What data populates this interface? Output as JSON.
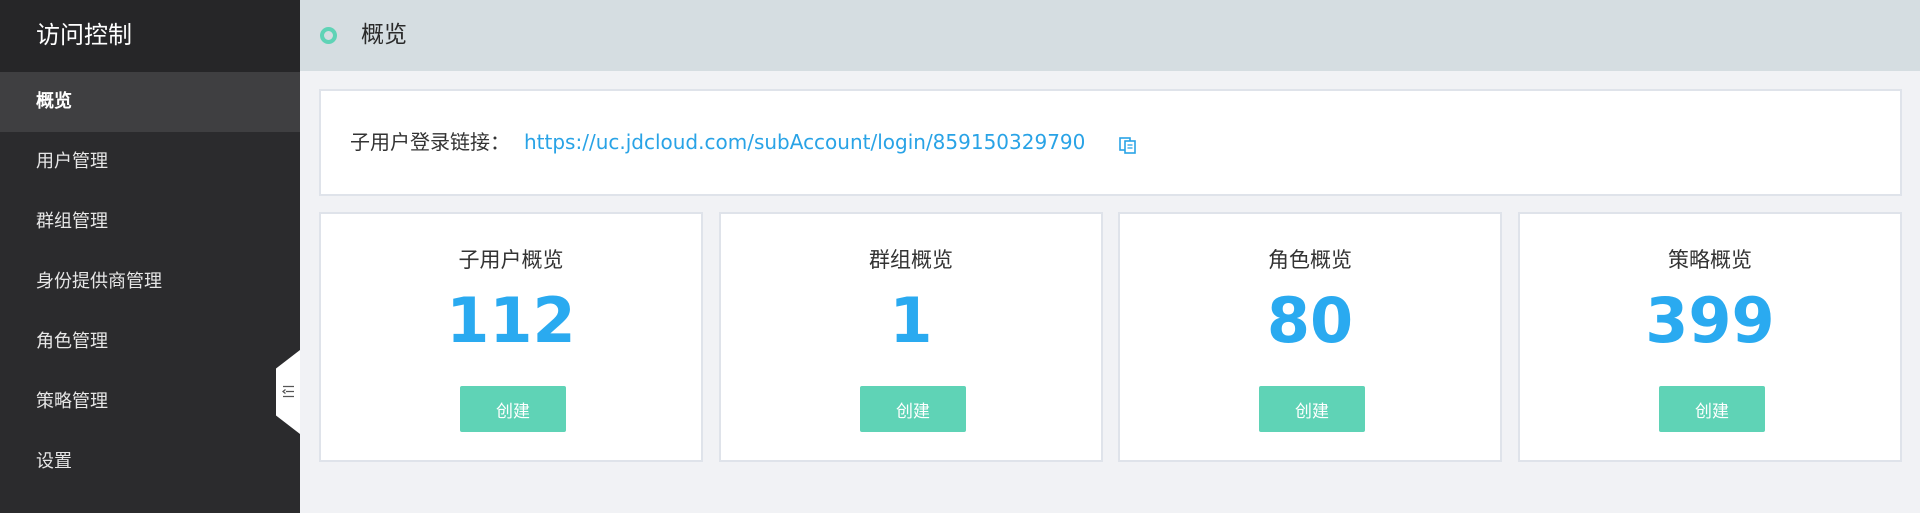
{
  "sidebar": {
    "title": "访问控制",
    "items": [
      {
        "label": "概览",
        "active": true
      },
      {
        "label": "用户管理"
      },
      {
        "label": "群组管理"
      },
      {
        "label": "身份提供商管理"
      },
      {
        "label": "角色管理"
      },
      {
        "label": "策略管理"
      },
      {
        "label": "设置"
      }
    ]
  },
  "header": {
    "title": "概览"
  },
  "login_link": {
    "label": "子用户登录链接：",
    "url": "https://uc.jdcloud.com/subAccount/login/859150329790"
  },
  "cards": [
    {
      "title": "子用户概览",
      "count": "112",
      "button": "创建"
    },
    {
      "title": "群组概览",
      "count": "1",
      "button": "创建"
    },
    {
      "title": "角色概览",
      "count": "80",
      "button": "创建"
    },
    {
      "title": "策略概览",
      "count": "399",
      "button": "创建"
    }
  ],
  "colors": {
    "accent": "#5fd3b6",
    "number": "#2aaaf0",
    "link": "#29a3e6",
    "sidebar_bg": "#2b2b2d",
    "topbar_bg": "#d5dde1"
  },
  "icons": {
    "header": "status-ring-icon",
    "copy": "copy-icon",
    "collapse": "collapse-left-icon"
  }
}
